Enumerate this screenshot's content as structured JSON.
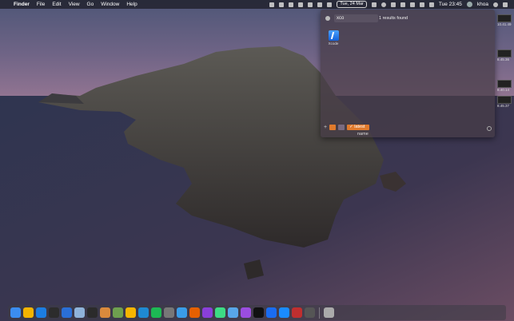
{
  "menubar": {
    "apple": "",
    "app_name": "Finder",
    "menus": [
      "File",
      "Edit",
      "View",
      "Go",
      "Window",
      "Help"
    ],
    "date": "Tue, 24 Mar",
    "clock": "Tue 23:45",
    "user": "khoa"
  },
  "search": {
    "query": "xco",
    "count_label": "1 results found",
    "result_label": "Xcode",
    "tag_label": "latest",
    "sub_label": "name"
  },
  "side_thumbs": [
    "10.41.49",
    "8.45.36",
    "8.40.14",
    "8.45.37"
  ],
  "colors": {
    "menubar_bg": "#1e1e28",
    "tag_orange": "#e07a2c",
    "panel_bg": "#463c46"
  },
  "dock": {
    "icons": [
      {
        "name": "finder-icon",
        "color": "#3b8df0"
      },
      {
        "name": "chrome-icon",
        "color": "#f4b400"
      },
      {
        "name": "xcode-icon",
        "color": "#1c7de2"
      },
      {
        "name": "terminal-icon",
        "color": "#2c2c2c"
      },
      {
        "name": "xcode-beta-icon",
        "color": "#2a6fd6"
      },
      {
        "name": "preview-icon",
        "color": "#8fb3d9"
      },
      {
        "name": "activity-monitor-icon",
        "color": "#2b2b2b"
      },
      {
        "name": "script-editor-icon",
        "color": "#d98a3c"
      },
      {
        "name": "maps-icon",
        "color": "#6ea04f"
      },
      {
        "name": "sketch-icon",
        "color": "#f7b500"
      },
      {
        "name": "vscode-icon",
        "color": "#1f8ad2"
      },
      {
        "name": "spotify-icon",
        "color": "#1db954"
      },
      {
        "name": "settings-icon",
        "color": "#777"
      },
      {
        "name": "safari-icon",
        "color": "#3a9de8"
      },
      {
        "name": "firefox-icon",
        "color": "#e66000"
      },
      {
        "name": "firefox-nightly-icon",
        "color": "#8a3fd9"
      },
      {
        "name": "android-studio-icon",
        "color": "#3ddc84"
      },
      {
        "name": "folder-icon",
        "color": "#58a6e8"
      },
      {
        "name": "podcasts-icon",
        "color": "#9b4de0"
      },
      {
        "name": "appletv-icon",
        "color": "#111"
      },
      {
        "name": "1password-icon",
        "color": "#1a6cf0"
      },
      {
        "name": "app-store-icon",
        "color": "#1a8cff"
      },
      {
        "name": "flashcard-icon",
        "color": "#c02f2f"
      },
      {
        "name": "toolbox-icon",
        "color": "#555"
      },
      {
        "name": "trash-icon",
        "color": "#aaa"
      }
    ]
  }
}
